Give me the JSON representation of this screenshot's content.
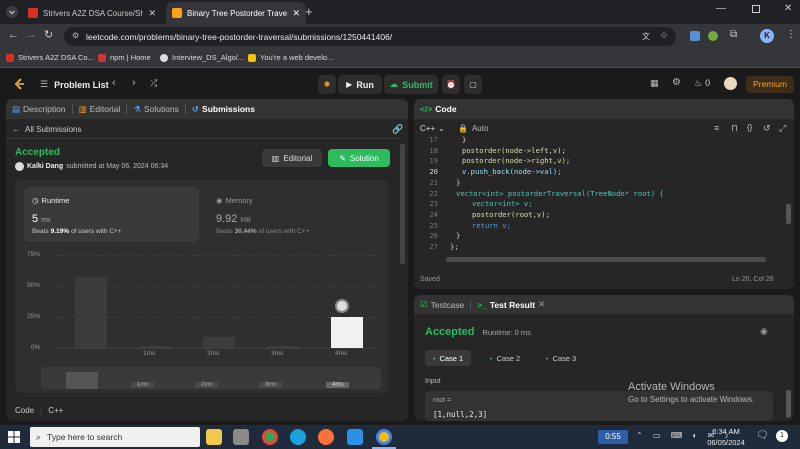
{
  "browser": {
    "tabs": [
      {
        "title": "Strivers A2Z DSA Course/Sheet",
        "favicon_color": "#d93025",
        "active": false
      },
      {
        "title": "Binary Tree Postorder Traversal",
        "favicon_color": "#ffa116",
        "active": true
      }
    ],
    "url": "leetcode.com/problems/binary-tree-postorder-traversal/submissions/1250441406/",
    "bookmarks": [
      {
        "label": "Strivers A2Z DSA Co..."
      },
      {
        "label": "npm | Home"
      },
      {
        "label": "Interview_DS_Algo/..."
      },
      {
        "label": "You're a web develo..."
      }
    ],
    "profile_initial": "K"
  },
  "header": {
    "problem_list": "Problem List",
    "run": "Run",
    "submit": "Submit",
    "streak": "0",
    "premium": "Premium"
  },
  "left_panel": {
    "tabs": [
      "Description",
      "Editorial",
      "Solutions",
      "Submissions"
    ],
    "back_link": "All Submissions",
    "status": "Accepted",
    "author": "Kalki Dang",
    "submitted_text": "submitted at May 06, 2024 06:34",
    "editorial_btn": "Editorial",
    "solution_btn": "Solution",
    "runtime": {
      "label": "Runtime",
      "value": "5",
      "unit": "ms",
      "beats_prefix": "Beats",
      "beats_value": "9.19%",
      "beats_suffix": "of users with C++"
    },
    "memory": {
      "label": "Memory",
      "value": "9.92",
      "unit": "MB",
      "beats_prefix": "Beats",
      "beats_value": "30.44%",
      "beats_suffix": "of users with C++"
    },
    "chart_y_ticks": [
      "75%",
      "50%",
      "25%",
      "0%"
    ],
    "chart_x_ticks": [
      "1ms",
      "2ms",
      "3ms",
      "4ms"
    ],
    "mini_x_ticks": [
      "1ms",
      "2ms",
      "3ms",
      "4ms"
    ],
    "footer": {
      "code_label": "Code",
      "lang": "C++"
    }
  },
  "chart_data": {
    "type": "bar",
    "categories": [
      "0ms",
      "1ms",
      "2ms",
      "3ms",
      "4ms"
    ],
    "values": [
      57,
      2,
      9,
      2,
      25
    ],
    "ylim": [
      0,
      75
    ],
    "highlight_category": "4ms",
    "grid": true
  },
  "code_panel": {
    "title": "Code",
    "lang": "C++",
    "mode": "Auto",
    "saved": "Saved",
    "cursor": "Ln 20, Col 28",
    "lines": [
      {
        "n": "17",
        "text": "}"
      },
      {
        "n": "18",
        "text": "postorder(node->left,v);"
      },
      {
        "n": "19",
        "text": "postorder(node->right,v);"
      },
      {
        "n": "20",
        "text": "v.push_back(node->val);"
      },
      {
        "n": "21",
        "text": "}"
      },
      {
        "n": "22",
        "text": "vector<int> postorderTraversal(TreeNode* root) {"
      },
      {
        "n": "23",
        "text": "vector<int> v;"
      },
      {
        "n": "24",
        "text": "postorder(root,v);"
      },
      {
        "n": "25",
        "text": "return v;"
      },
      {
        "n": "26",
        "text": "}"
      },
      {
        "n": "27",
        "text": "};"
      }
    ]
  },
  "test_panel": {
    "tab1": "Testcase",
    "tab2": "Test Result",
    "status": "Accepted",
    "runtime": "Runtime: 0 ms",
    "cases": [
      "Case 1",
      "Case 2",
      "Case 3"
    ],
    "input_label": "Input",
    "input_var": "root =",
    "input_value": "[1,null,2,3]"
  },
  "watermark": {
    "line1": "Activate Windows",
    "line2": "Go to Settings to activate Windows."
  },
  "taskbar": {
    "search_placeholder": "Type here to search",
    "time": "6:34 AM",
    "date": "06/05/2024",
    "timer": "0:55",
    "notifications": "1"
  }
}
